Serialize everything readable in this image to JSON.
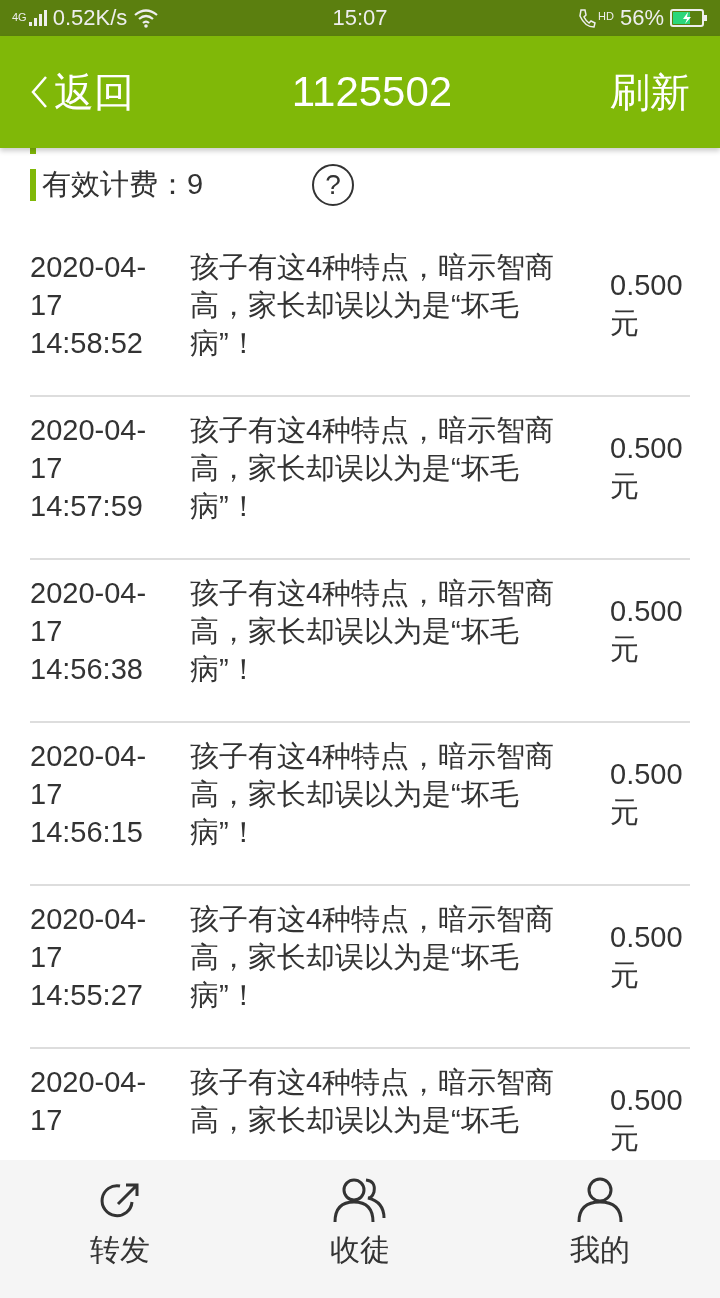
{
  "status_bar": {
    "network": "4G",
    "speed": "0.52K/s",
    "time": "15:07",
    "call_badge": "HD",
    "battery": "56%"
  },
  "header": {
    "back": "返回",
    "title": "1125502",
    "action": "刷新"
  },
  "summary": {
    "label": "有效计费：9",
    "help": "?"
  },
  "records": [
    {
      "datetime": "2020-04-17 14:58:52",
      "title": "孩子有这4种特点，暗示智商高，家长却误以为是“坏毛病”！",
      "amount": "0.500元"
    },
    {
      "datetime": "2020-04-17 14:57:59",
      "title": "孩子有这4种特点，暗示智商高，家长却误以为是“坏毛病”！",
      "amount": "0.500元"
    },
    {
      "datetime": "2020-04-17 14:56:38",
      "title": "孩子有这4种特点，暗示智商高，家长却误以为是“坏毛病”！",
      "amount": "0.500元"
    },
    {
      "datetime": "2020-04-17 14:56:15",
      "title": "孩子有这4种特点，暗示智商高，家长却误以为是“坏毛病”！",
      "amount": "0.500元"
    },
    {
      "datetime": "2020-04-17 14:55:27",
      "title": "孩子有这4种特点，暗示智商高，家长却误以为是“坏毛病”！",
      "amount": "0.500元"
    },
    {
      "datetime": "2020-04-17",
      "title": "孩子有这4种特点，暗示智商高，家长却误以为是“坏毛",
      "amount": "0.500元"
    }
  ],
  "tab_bar": [
    {
      "kind": "share",
      "label": "转发"
    },
    {
      "kind": "group",
      "label": "收徒"
    },
    {
      "kind": "person",
      "label": "我的"
    }
  ]
}
